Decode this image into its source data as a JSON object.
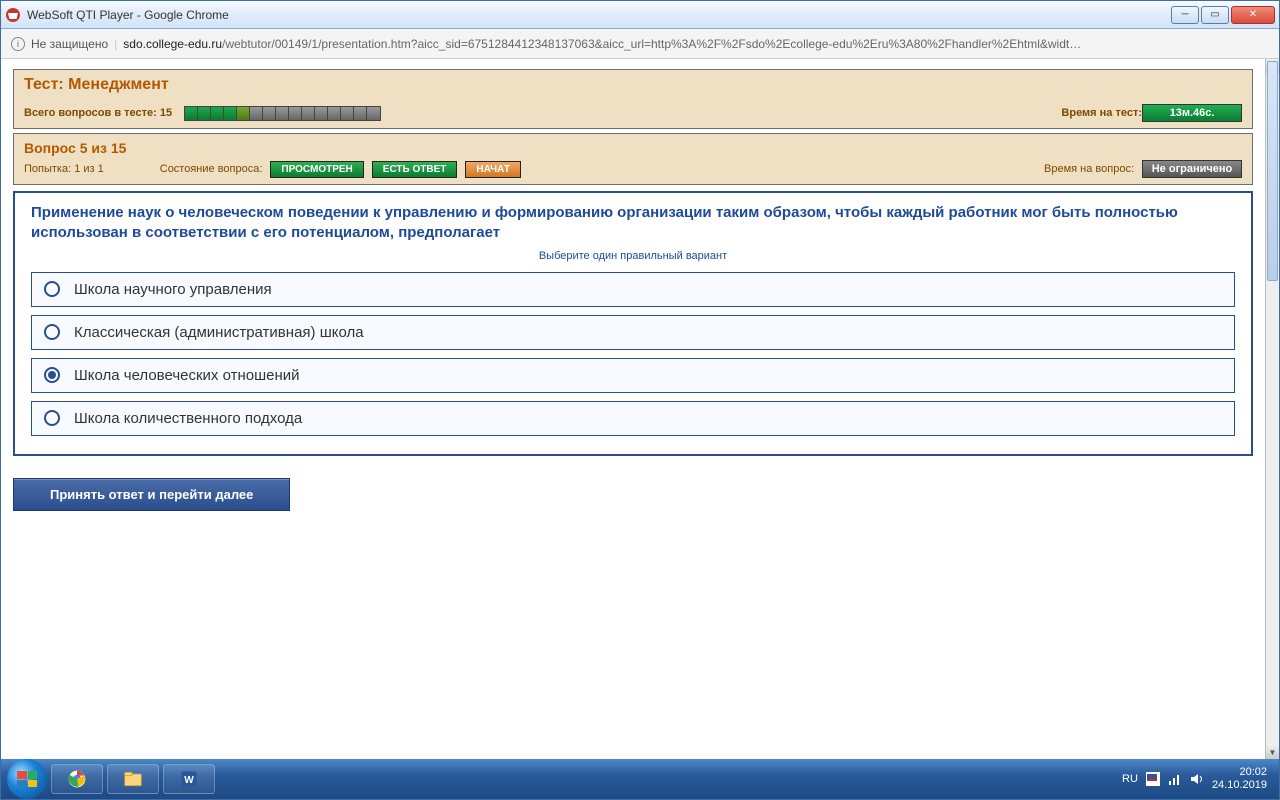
{
  "window": {
    "title": "WebSoft QTI Player - Google Chrome"
  },
  "browser": {
    "not_secure_label": "Не защищено",
    "url_host": "sdo.college-edu.ru",
    "url_rest": "/webtutor/00149/1/presentation.htm?aicc_sid=6751284412348137063&aicc_url=http%3A%2F%2Fsdo%2Ecollege-edu%2Eru%3A80%2Fhandler%2Ehtml&widt…"
  },
  "test_header": {
    "title": "Тест: Менеджмент",
    "total_label": "Всего вопросов в тесте: 15",
    "progress_total": 15,
    "progress_done": 4,
    "time_test_label": "Время на тест:",
    "time_test_value": "13м.46с."
  },
  "question_header": {
    "counter": "Вопрос 5 из 15",
    "attempt_label": "Попытка: 1 из 1",
    "state_label": "Состояние вопроса:",
    "state_viewed": "ПРОСМОТРЕН",
    "state_answered": "ЕСТЬ ОТВЕТ",
    "state_started": "НАЧАТ",
    "time_q_label": "Время на вопрос:",
    "time_q_value": "Не ограничено"
  },
  "question": {
    "text": "Применение наук о человеческом поведении к управлению и формированию организации таким образом, чтобы каждый работник мог быть полностью использован в соответствии с его потенциалом, предполагает",
    "hint": "Выберите один правильный вариант",
    "options": [
      {
        "label": "Школа научного управления",
        "selected": false
      },
      {
        "label": "Классическая (административная) школа",
        "selected": false
      },
      {
        "label": "Школа человеческих отношений",
        "selected": true
      },
      {
        "label": "Школа количественного подхода",
        "selected": false
      }
    ],
    "submit_label": "Принять ответ и перейти далее"
  },
  "tray": {
    "lang": "RU",
    "time": "20:02",
    "date": "24.10.2019"
  }
}
